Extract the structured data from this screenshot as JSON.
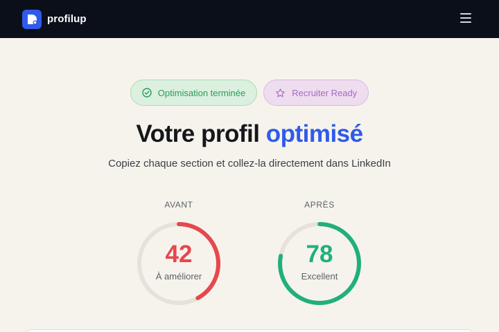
{
  "header": {
    "brand": "profilup",
    "logo_icon": "profilup-logo-icon",
    "menu_icon": "hamburger-menu-icon"
  },
  "badges": [
    {
      "label": "Optimisation terminée",
      "icon": "check-circle-icon",
      "color": "#2a9c5a"
    },
    {
      "label": "Recruiter Ready",
      "icon": "star-icon",
      "color": "#a66ac8"
    }
  ],
  "hero": {
    "title_main": "Votre profil",
    "title_accent": "optimisé",
    "subtitle": "Copiez chaque section et collez-la directement dans LinkedIn"
  },
  "scores": {
    "before": {
      "label": "AVANT",
      "value": "42",
      "fraction": 0.42,
      "caption": "À améliorer",
      "color": "#e5484d"
    },
    "after": {
      "label": "APRÈS",
      "value": "78",
      "fraction": 0.78,
      "caption": "Excellent",
      "color": "#20b07a"
    }
  },
  "colors": {
    "accent": "#2f5bea",
    "header_bg": "#0b0f1a",
    "page_bg": "#f6f3ec"
  }
}
